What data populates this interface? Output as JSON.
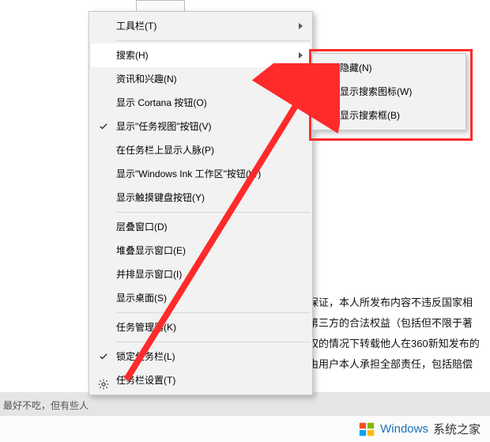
{
  "background": {
    "paragraph_lines": [
      "保证，本人所发布内容不违反国家相",
      "第三方的合法权益（包括但不限于著",
      "权的情况下转载他人在360新知发布的",
      "由用户本人承担全部责任，包括赔偿"
    ],
    "strip_text": "最好不吃，但有些人"
  },
  "main_menu": {
    "items": [
      {
        "label": "工具栏(T)",
        "arrow": true
      },
      {
        "sep": true
      },
      {
        "label": "搜索(H)",
        "arrow": true,
        "hover": true
      },
      {
        "label": "资讯和兴趣(N)",
        "arrow": true
      },
      {
        "label": "显示 Cortana 按钮(O)"
      },
      {
        "label": "显示\"任务视图\"按钮(V)",
        "check": true
      },
      {
        "label": "在任务栏上显示人脉(P)"
      },
      {
        "label": "显示\"Windows Ink 工作区\"按钮(W)"
      },
      {
        "label": "显示触摸键盘按钮(Y)"
      },
      {
        "sep": true
      },
      {
        "label": "层叠窗口(D)"
      },
      {
        "label": "堆叠显示窗口(E)"
      },
      {
        "label": "并排显示窗口(I)"
      },
      {
        "label": "显示桌面(S)"
      },
      {
        "sep": true
      },
      {
        "label": "任务管理器(K)"
      },
      {
        "sep": true
      },
      {
        "label": "锁定任务栏(L)",
        "check": true
      },
      {
        "label": "任务栏设置(T)",
        "gear": true
      }
    ]
  },
  "sub_menu": {
    "items": [
      {
        "label": "隐藏(N)",
        "check": true
      },
      {
        "label": "显示搜索图标(W)"
      },
      {
        "label": "显示搜索框(B)"
      }
    ]
  },
  "footer": {
    "brand_en": "Windows",
    "brand_cn": "系统之家"
  }
}
